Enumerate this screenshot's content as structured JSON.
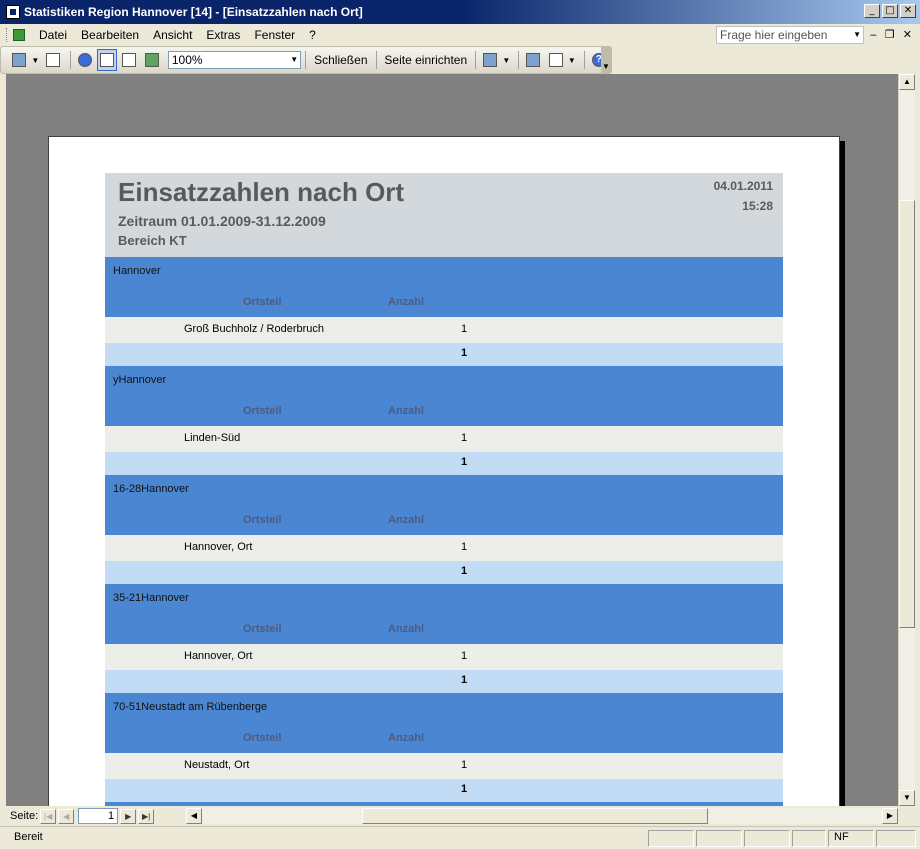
{
  "window": {
    "title": "Statistiken Region Hannover [14] - [Einsatzzahlen nach Ort]",
    "btn_min": "_",
    "btn_max": "□",
    "btn_close": "✕"
  },
  "menu": {
    "items": [
      "Datei",
      "Bearbeiten",
      "Ansicht",
      "Extras",
      "Fenster",
      "?"
    ],
    "help_placeholder": "Frage hier eingeben",
    "mdi_min": "‒",
    "mdi_restore": "❐",
    "mdi_close": "✕"
  },
  "toolbar": {
    "zoom": "100%",
    "close_label": "Schließen",
    "page_setup_label": "Seite einrichten"
  },
  "report": {
    "title": "Einsatzzahlen nach Ort",
    "period": "Zeitraum 01.01.2009-31.12.2009",
    "area": "Bereich KT",
    "date": "04.01.2011",
    "time": "15:28",
    "col_ortsteil": "Ortsteil",
    "col_anzahl": "Anzahl",
    "groups": [
      {
        "name": "Hannover",
        "rows": [
          {
            "ort": "Groß Buchholz / Roderbruch",
            "anzahl": "1"
          }
        ],
        "total": "1"
      },
      {
        "name": "yHannover",
        "rows": [
          {
            "ort": "Linden-Süd",
            "anzahl": "1"
          }
        ],
        "total": "1"
      },
      {
        "name": "16-28Hannover",
        "rows": [
          {
            "ort": "Hannover, Ort",
            "anzahl": "1"
          }
        ],
        "total": "1"
      },
      {
        "name": "35-21Hannover",
        "rows": [
          {
            "ort": "Hannover, Ort",
            "anzahl": "1"
          }
        ],
        "total": "1"
      },
      {
        "name": "70-51Neustadt am Rübenberge",
        "rows": [
          {
            "ort": "Neustadt, Ort",
            "anzahl": "1"
          }
        ],
        "total": "1"
      }
    ]
  },
  "nav": {
    "label": "Seite:",
    "page": "1"
  },
  "status": {
    "text": "Bereit",
    "indicator": "NF"
  }
}
